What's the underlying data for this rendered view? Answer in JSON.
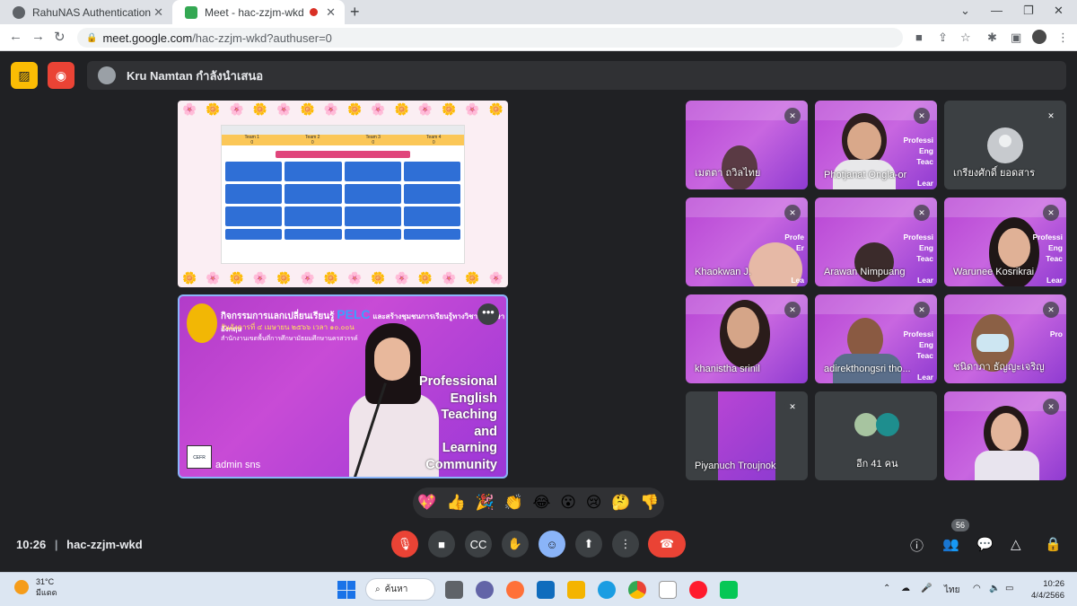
{
  "browser": {
    "tabs": [
      {
        "title": "RahuNAS Authentication"
      },
      {
        "title": "Meet - hac-zzjm-wkd"
      }
    ],
    "url_host": "meet.google.com",
    "url_path": "/hac-zzjm-wkd?authuser=0"
  },
  "meet": {
    "presenter_text": "Kru Namtan กำลังนำเสนอ",
    "shared_screen": {
      "teams": [
        "Team 1",
        "Team 2",
        "Team 3",
        "Team 4"
      ],
      "scores": [
        "0",
        "0",
        "0",
        "0"
      ]
    },
    "speaker": {
      "name": "admin sns",
      "heading_th": "กิจกรรมการแลกเปลี่ยนเรียนรู้",
      "heading_pelc": "PELC",
      "heading_th2": "และสร้างชุมชนการเรียนรู้ทางวิชาชีพภาษาอังกฤษ",
      "subline": "วันอังคารที่ ๔ เมษายน ๒๕๖๖ เวลา ๑๐.๐๐น",
      "subline2": "สำนักงานเขตพื้นที่การศึกษามัธยมศึกษานครสวรรค์",
      "side_lines": [
        "Professional",
        "English",
        "Teaching",
        "and",
        "Learning",
        "Community"
      ],
      "badge": "CEFR"
    },
    "participants": [
      {
        "name": "เมตตา ถวิลไทย",
        "muted": true
      },
      {
        "name": "Photjanat Ongla-or",
        "muted": true
      },
      {
        "name": "เกรียงศักดิ์ ยอดสาร",
        "muted": true
      },
      {
        "name": "Khaokwan J.",
        "muted": true
      },
      {
        "name": "Arawan Nimpuang",
        "muted": true
      },
      {
        "name": "Warunee Kosrikrai",
        "muted": true
      },
      {
        "name": "khanistha srinil",
        "muted": true
      },
      {
        "name": "adirekthongsri tho...",
        "muted": true
      },
      {
        "name": "ชนิดาภา ธัญญะเจริญ",
        "muted": true
      },
      {
        "name": "Piyanuch Troujnok",
        "muted": true
      },
      {
        "name": "อีก 41 คน",
        "muted": false
      },
      {
        "name": "",
        "muted": true
      }
    ],
    "reactions": [
      "💖",
      "👍",
      "🎉",
      "👏",
      "😂",
      "😮",
      "😢",
      "🤔",
      "👎"
    ],
    "time": "10:26",
    "meeting_code": "hac-zzjm-wkd",
    "people_count": "56"
  },
  "taskbar": {
    "temperature": "31°C",
    "weather_desc": "มีแดด",
    "search_label": "ค้นหา",
    "lang": "ไทย",
    "clock_time": "10:26",
    "clock_date": "4/4/2566"
  },
  "colors": {
    "meet_bg": "#202124",
    "hangup": "#ea4335",
    "purple_slide": "#b845d4",
    "active_border": "#8ab4f8"
  }
}
